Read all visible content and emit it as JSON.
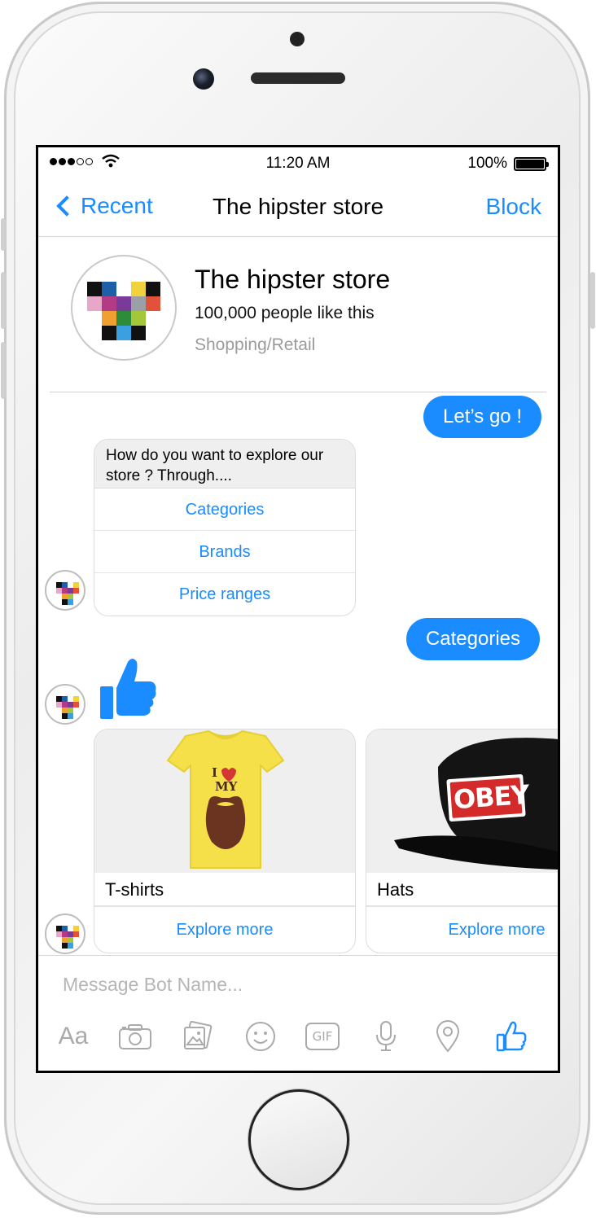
{
  "status_bar": {
    "time": "11:20 AM",
    "battery": "100%"
  },
  "navbar": {
    "back_label": "Recent",
    "title": "The hipster store",
    "action_label": "Block"
  },
  "profile": {
    "name": "The hipster store",
    "likes": "100,000 people like this",
    "category": "Shopping/Retail"
  },
  "messages": {
    "user_1": "Let’s go !",
    "bot_question": "How do you want to explore our store ? Through....",
    "options": [
      "Categories",
      "Brands",
      "Price ranges"
    ],
    "user_2": "Categories"
  },
  "products": [
    {
      "name": "T-shirts",
      "action": "Explore more",
      "print_line1": "I",
      "print_line2": "MY"
    },
    {
      "name": "Hats",
      "action": "Explore more",
      "logo_text": "OBEY"
    }
  ],
  "composer": {
    "placeholder": "Message Bot Name...",
    "text_tool": "Aa",
    "gif_tool": "GIF"
  },
  "colors": {
    "accent": "#1a8cff",
    "bubble_bg": "#efefef",
    "placeholder": "#b5b5b5"
  },
  "icons": [
    "back-chevron-icon",
    "camera-icon",
    "photo-icon",
    "emoji-icon",
    "gif-icon",
    "microphone-icon",
    "location-icon",
    "thumbs-up-icon"
  ]
}
